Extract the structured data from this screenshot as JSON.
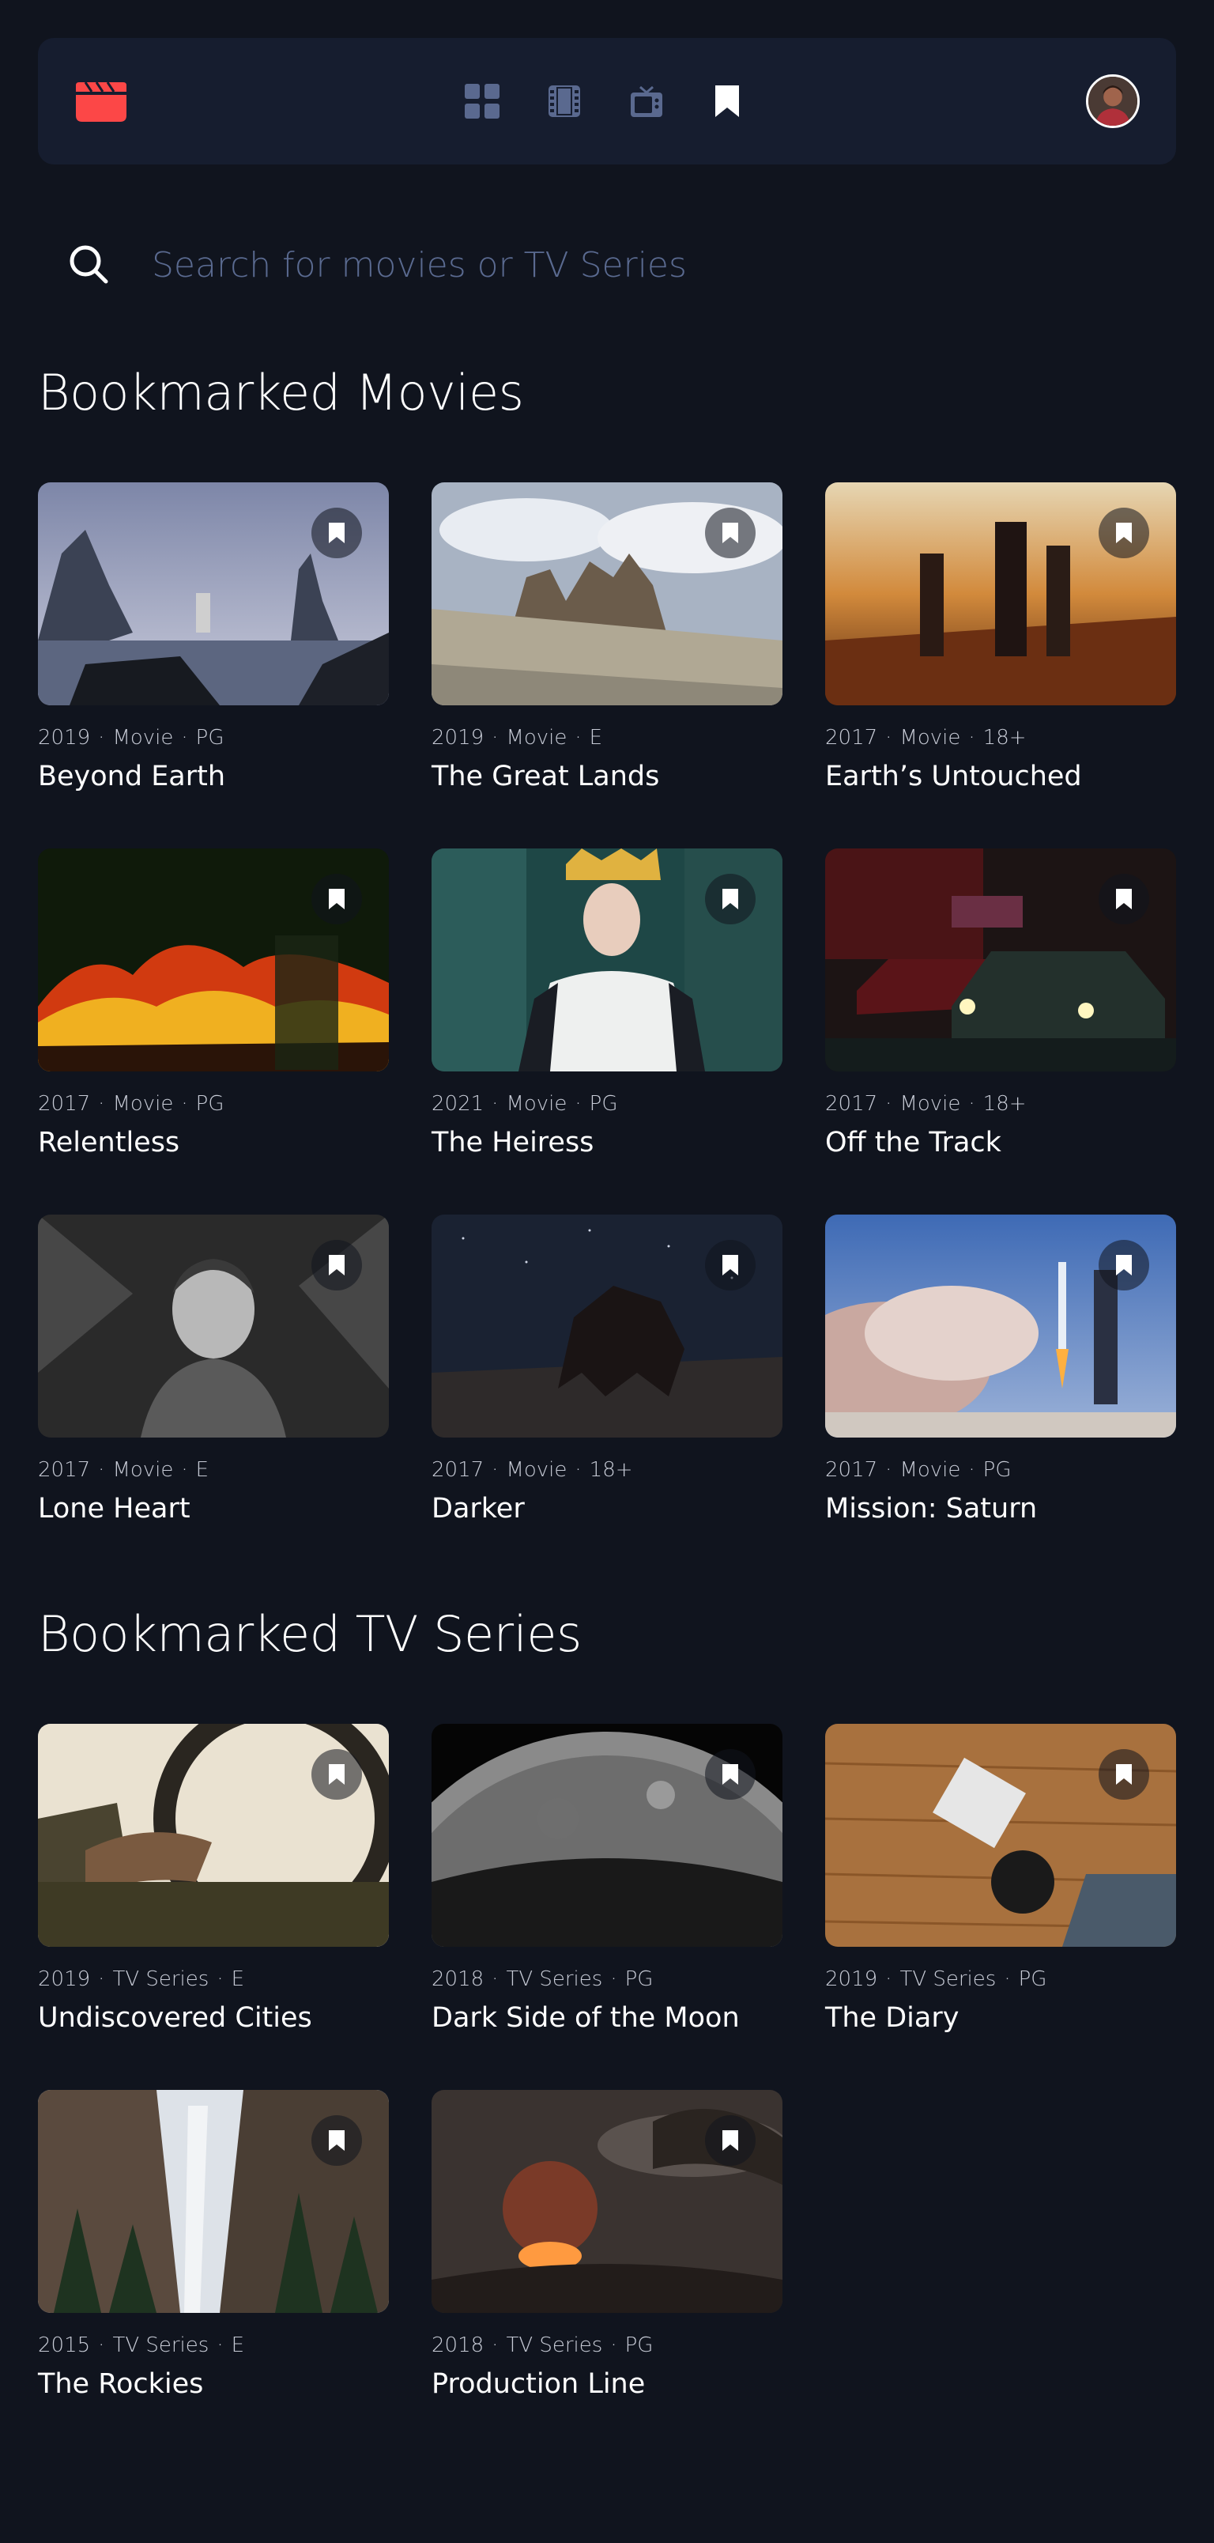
{
  "search": {
    "placeholder": "Search for movies or TV Series"
  },
  "nav": {
    "items": [
      {
        "icon": "home-grid-icon",
        "active": false
      },
      {
        "icon": "film-icon",
        "active": false
      },
      {
        "icon": "tv-icon",
        "active": false
      },
      {
        "icon": "bookmark-icon",
        "active": true
      }
    ]
  },
  "colors": {
    "accent": "#FC4747",
    "background": "#10141E",
    "surface": "#161D2F",
    "muted": "#5A698F"
  },
  "movies": {
    "heading": "Bookmarked Movies",
    "items": [
      {
        "year": "2019",
        "category": "Movie",
        "rating": "PG",
        "title": "Beyond Earth"
      },
      {
        "year": "2019",
        "category": "Movie",
        "rating": "E",
        "title": "The Great Lands"
      },
      {
        "year": "2017",
        "category": "Movie",
        "rating": "18+",
        "title": "Earth’s Untouched"
      },
      {
        "year": "2017",
        "category": "Movie",
        "rating": "PG",
        "title": "Relentless"
      },
      {
        "year": "2021",
        "category": "Movie",
        "rating": "PG",
        "title": "The Heiress"
      },
      {
        "year": "2017",
        "category": "Movie",
        "rating": "18+",
        "title": "Off the Track"
      },
      {
        "year": "2017",
        "category": "Movie",
        "rating": "E",
        "title": "Lone Heart"
      },
      {
        "year": "2017",
        "category": "Movie",
        "rating": "18+",
        "title": "Darker"
      },
      {
        "year": "2017",
        "category": "Movie",
        "rating": "PG",
        "title": "Mission: Saturn"
      }
    ]
  },
  "series": {
    "heading": "Bookmarked TV Series",
    "items": [
      {
        "year": "2019",
        "category": "TV Series",
        "rating": "E",
        "title": "Undiscovered Cities"
      },
      {
        "year": "2018",
        "category": "TV Series",
        "rating": "PG",
        "title": "Dark Side of the Moon"
      },
      {
        "year": "2019",
        "category": "TV Series",
        "rating": "PG",
        "title": "The Diary"
      },
      {
        "year": "2015",
        "category": "TV Series",
        "rating": "E",
        "title": "The Rockies"
      },
      {
        "year": "2018",
        "category": "TV Series",
        "rating": "PG",
        "title": "Production Line"
      }
    ]
  }
}
